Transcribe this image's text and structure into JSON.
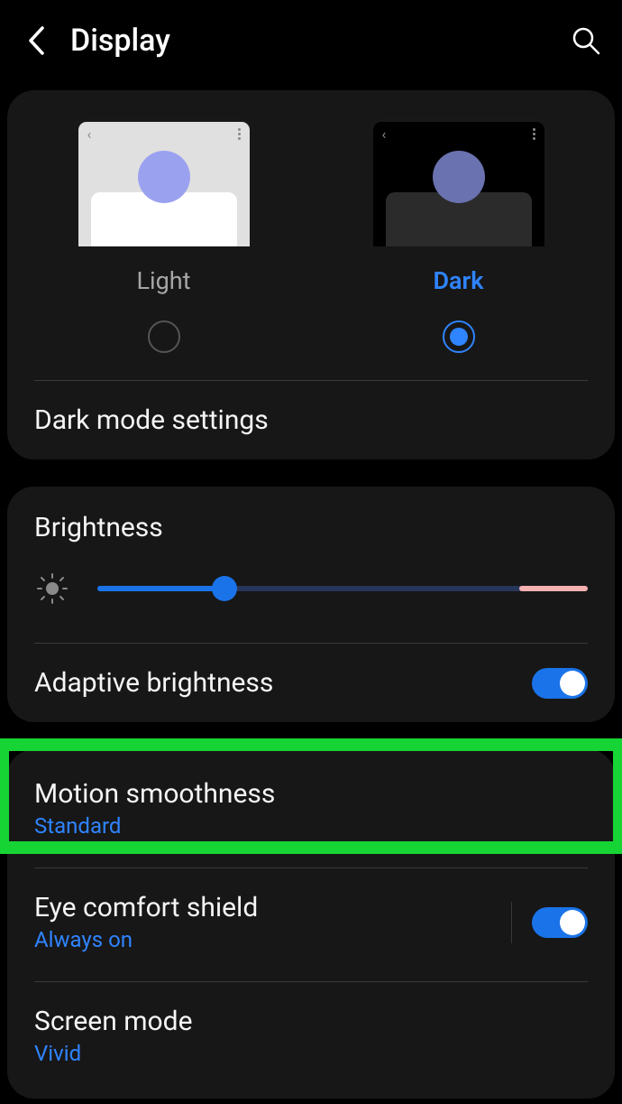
{
  "header": {
    "title": "Display"
  },
  "theme": {
    "light_label": "Light",
    "dark_label": "Dark",
    "selected": "dark"
  },
  "dark_mode_settings_label": "Dark mode settings",
  "brightness": {
    "label": "Brightness",
    "value_percent": 26,
    "adaptive_label": "Adaptive brightness",
    "adaptive_on": true
  },
  "motion_smoothness": {
    "label": "Motion smoothness",
    "value": "Standard"
  },
  "eye_comfort": {
    "label": "Eye comfort shield",
    "value": "Always on",
    "on": true
  },
  "screen_mode": {
    "label": "Screen mode",
    "value": "Vivid"
  },
  "colors": {
    "accent": "#2f84ff",
    "highlight": "#17d435"
  }
}
